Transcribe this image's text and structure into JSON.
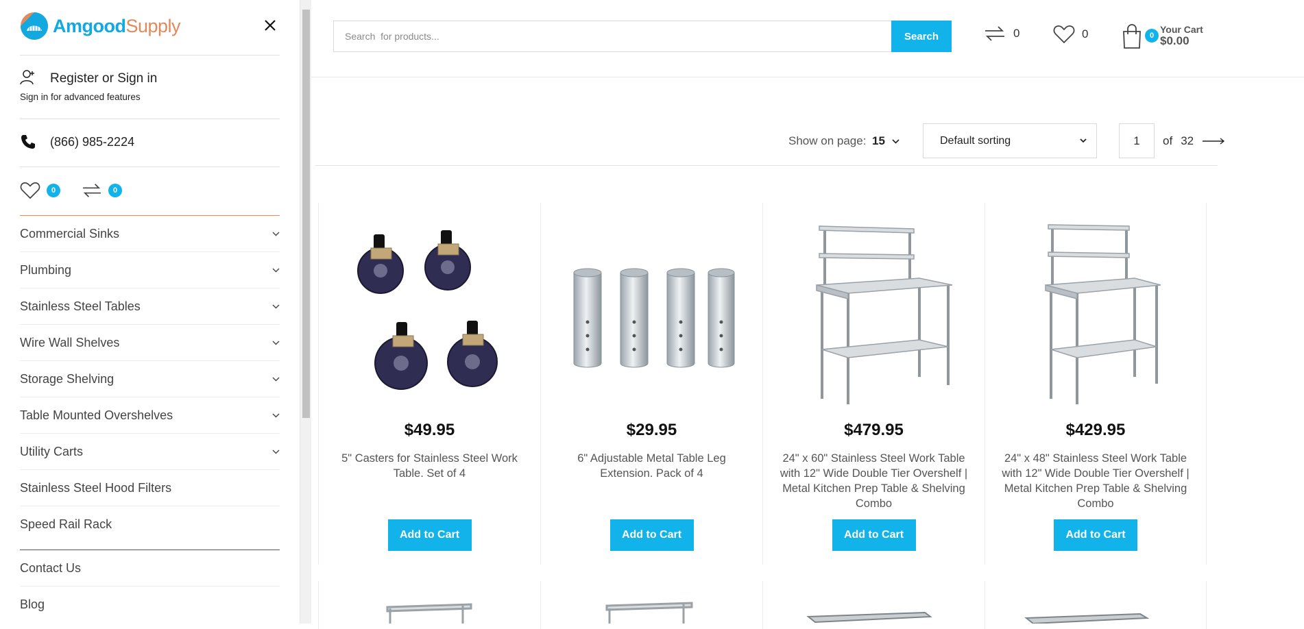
{
  "header": {
    "search_placeholder": "Search  for products...",
    "search_button": "Search",
    "compare_count": "0",
    "wishlist_count": "0",
    "cart_badge": "0",
    "cart_label": "Your Cart",
    "cart_total": "$0.00"
  },
  "toolbar": {
    "show_label": "Show on page:",
    "show_value": "15",
    "sort_value": "Default sorting",
    "page_current": "1",
    "page_of": "of",
    "page_total": "32"
  },
  "products": [
    {
      "price": "$49.95",
      "name": "5\" Casters for Stainless Steel Work Table. Set of 4",
      "button": "Add to Cart"
    },
    {
      "price": "$29.95",
      "name": "6\" Adjustable Metal Table Leg Extension. Pack of 4",
      "button": "Add to Cart"
    },
    {
      "price": "$479.95",
      "name": "24\" x 60\" Stainless Steel Work Table with 12\" Wide Double Tier Overshelf | Metal Kitchen Prep Table & Shelving Combo",
      "button": "Add to Cart"
    },
    {
      "price": "$429.95",
      "name": "24\" x 48\" Stainless Steel Work Table with 12\" Wide Double Tier Overshelf | Metal Kitchen Prep Table & Shelving Combo",
      "button": "Add to Cart"
    }
  ],
  "sidebar": {
    "logo_main": "Amgood",
    "logo_sub": "Supply",
    "account_title": "Register or Sign in",
    "account_sub": "Sign in for advanced features",
    "phone": "(866) 985-2224",
    "wishlist_count": "0",
    "compare_count": "0",
    "menu": [
      {
        "label": "Commercial Sinks",
        "expandable": true
      },
      {
        "label": "Plumbing",
        "expandable": true
      },
      {
        "label": "Stainless Steel Tables",
        "expandable": true
      },
      {
        "label": "Wire Wall Shelves",
        "expandable": true
      },
      {
        "label": "Storage Shelving",
        "expandable": true
      },
      {
        "label": "Table Mounted Overshelves",
        "expandable": true
      },
      {
        "label": "Utility Carts",
        "expandable": true
      },
      {
        "label": "Stainless Steel Hood Filters",
        "expandable": false
      },
      {
        "label": "Speed Rail Rack",
        "expandable": false
      }
    ],
    "menu_secondary": [
      {
        "label": "Contact Us"
      },
      {
        "label": "Blog"
      }
    ]
  },
  "colors": {
    "accent": "#12b3ea",
    "brand_orange": "#e08a5c"
  }
}
